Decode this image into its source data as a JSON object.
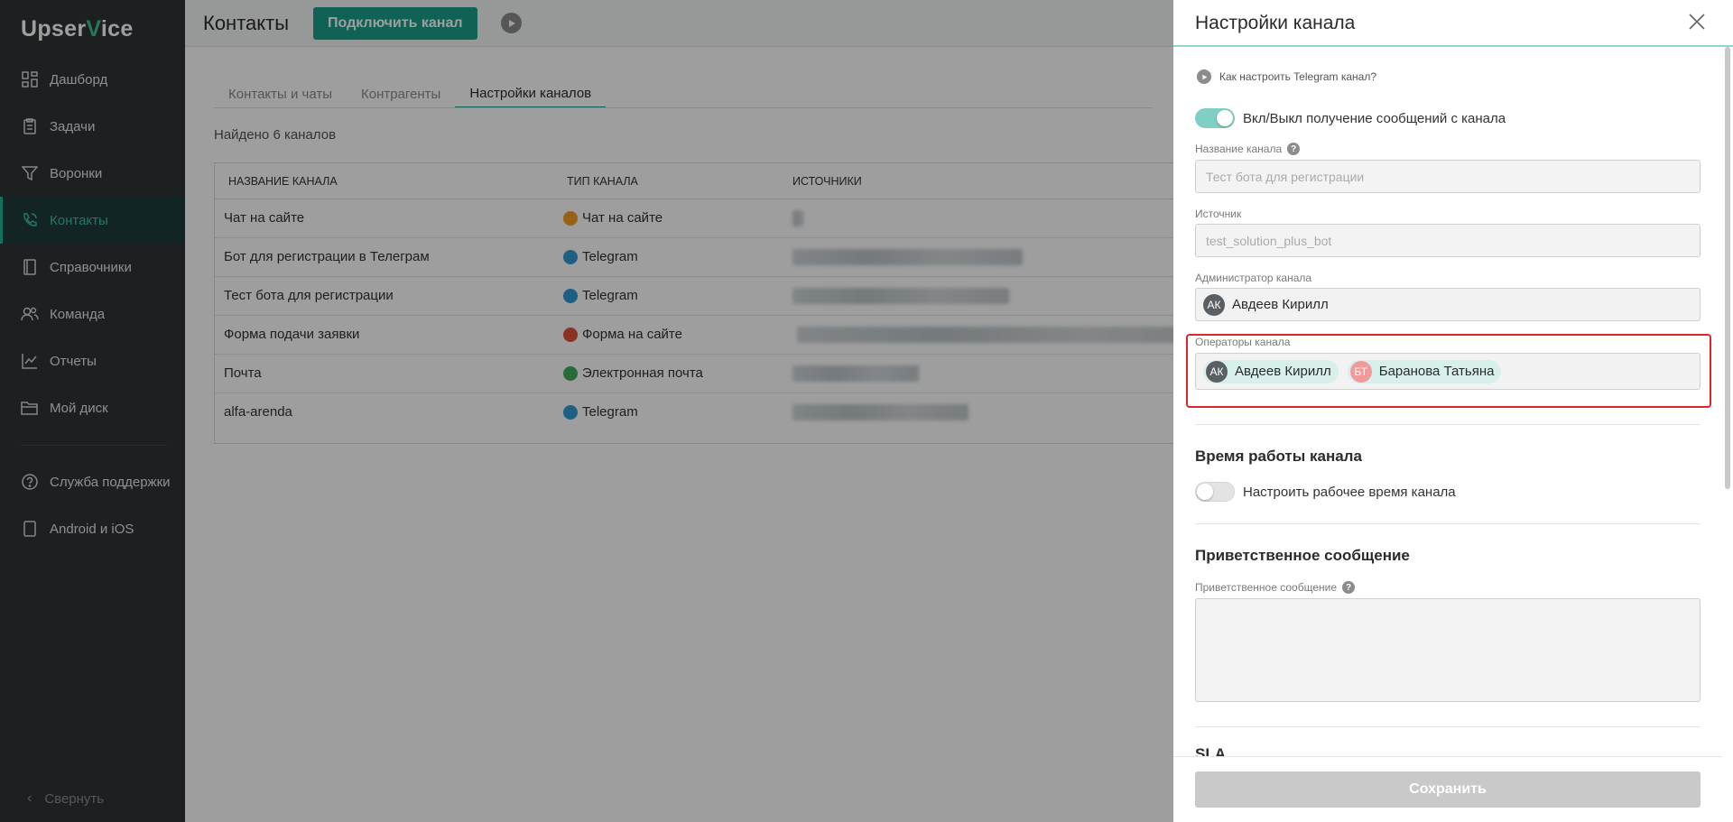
{
  "sidebar": {
    "logo_a": "Upser",
    "logo_check": "V",
    "logo_b": "ice",
    "items": [
      {
        "label": "Дашборд",
        "icon": "dashboard-icon"
      },
      {
        "label": "Задачи",
        "icon": "tasks-icon"
      },
      {
        "label": "Воронки",
        "icon": "funnel-icon"
      },
      {
        "label": "Контакты",
        "icon": "phone-icon",
        "active": true
      },
      {
        "label": "Справочники",
        "icon": "book-icon"
      },
      {
        "label": "Команда",
        "icon": "team-icon"
      },
      {
        "label": "Отчеты",
        "icon": "chart-icon"
      },
      {
        "label": "Мой диск",
        "icon": "folder-icon"
      }
    ],
    "items2": [
      {
        "label": "Служба поддержки",
        "icon": "help-icon"
      },
      {
        "label": "Android и iOS",
        "icon": "mobile-icon"
      }
    ],
    "collapse_label": "Свернуть"
  },
  "header": {
    "title": "Контакты",
    "connect_button": "Подключить канал"
  },
  "tabs": [
    "Контакты и чаты",
    "Контрагенты",
    "Настройки каналов"
  ],
  "found_text": "Найдено 6 каналов",
  "table": {
    "headers": [
      "НАЗВАНИЕ КАНАЛА",
      "ТИП КАНАЛА",
      "ИСТОЧНИКИ"
    ],
    "rows": [
      {
        "name": "Чат на сайте",
        "type": "Чат на сайте",
        "type_color": "#f0a020"
      },
      {
        "name": "Бот для регистрации в Телеграм",
        "type": "Telegram",
        "type_color": "#2f9bd6"
      },
      {
        "name": "Тест бота для регистрации",
        "type": "Telegram",
        "type_color": "#2f9bd6"
      },
      {
        "name": "Форма подачи заявки",
        "type": "Форма на сайте",
        "type_color": "#e0523a"
      },
      {
        "name": "Почта",
        "type": "Электронная почта",
        "type_color": "#3fae5a"
      },
      {
        "name": "alfa-arenda",
        "type": "Telegram",
        "type_color": "#2f9bd6"
      }
    ]
  },
  "panel": {
    "title": "Настройки канала",
    "how_link": "Как настроить Telegram канал?",
    "toggle_receive_label": "Вкл/Выкл получение сообщений с канала",
    "toggle_receive_on": true,
    "name_label": "Название канала",
    "name_placeholder": "Тест бота для регистрации",
    "source_label": "Источник",
    "source_placeholder": "test_solution_plus_bot",
    "admin_label": "Администратор канала",
    "admin": {
      "initials": "АК",
      "name": "Авдеев Кирилл",
      "color": "#5a5f63"
    },
    "operators_label": "Операторы канала",
    "operators": [
      {
        "initials": "АК",
        "name": "Авдеев Кирилл",
        "color": "#5a5f63"
      },
      {
        "initials": "БТ",
        "name": "Баранова Татьяна",
        "color": "#f29a9a"
      }
    ],
    "work_time_title": "Время работы канала",
    "work_time_toggle_label": "Настроить рабочее время канала",
    "work_time_on": false,
    "welcome_title": "Приветственное сообщение",
    "welcome_label": "Приветственное сообщение",
    "sla_title": "SLA",
    "save_button": "Сохранить"
  }
}
